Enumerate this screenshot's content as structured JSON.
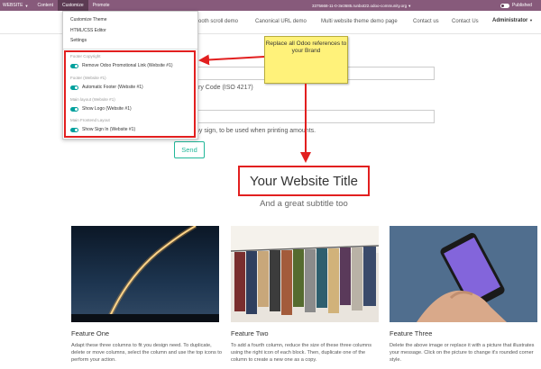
{
  "topbar": {
    "website_label": "WEBSITE",
    "content_label": "Content",
    "customize_label": "Customize",
    "promote_label": "Promote",
    "url": "3375668-11-0-3e3685.runbot22.odoo-community.org",
    "published_label": "Published"
  },
  "navbar": {
    "items": [
      "mooth scroll demo",
      "Canonical URL demo",
      "Multi website theme demo page",
      "Contact us",
      "Contact Us"
    ],
    "admin_label": "Administrator"
  },
  "customize_menu": {
    "items": [
      "Customize Theme",
      "HTML/CSS Editor",
      "Settings"
    ],
    "groups": [
      {
        "title": "Footer Copyright",
        "options": [
          "Remove Odoo Promotional Link (Website #1)"
        ]
      },
      {
        "title": "Footer (Website #1)",
        "options": [
          "Automatic Footer (Website #1)"
        ]
      },
      {
        "title": "Main layout (Website #1)",
        "options": [
          "Show Logo (Website #1)"
        ]
      },
      {
        "title": "Main Frontend Layout",
        "options": [
          "Show Sign In (Website #1)"
        ]
      }
    ]
  },
  "callout": {
    "text": "Replace all Odoo references to your Brand"
  },
  "form": {
    "currency_label": "ry Code (ISO 4217)",
    "required_label": "*",
    "signature_help": "ny sign, to be used when printing amounts.",
    "send_label": "Send"
  },
  "hero": {
    "title": "Your Website Title",
    "subtitle": "And a great subtitle too"
  },
  "features": [
    {
      "title": "Feature One",
      "text": "Adapt these three columns to fit you design need. To duplicate, delete or move columns, select the column and use the top icons to perform your action."
    },
    {
      "title": "Feature Two",
      "text": "To add a fourth column, reduce the size of these three columns using the right icon of each block. Then, duplicate one of the column to create a new one as a copy."
    },
    {
      "title": "Feature Three",
      "text": "Delete the above image or replace it with a picture that illustrates your message. Click on the picture to change it's rounded corner style."
    }
  ],
  "colors": {
    "odoo_purple": "#875a7b",
    "accent_red": "#e21f1f",
    "callout_yellow": "#fff27a",
    "switch_teal": "#00a09d",
    "send_green": "#21b799"
  }
}
